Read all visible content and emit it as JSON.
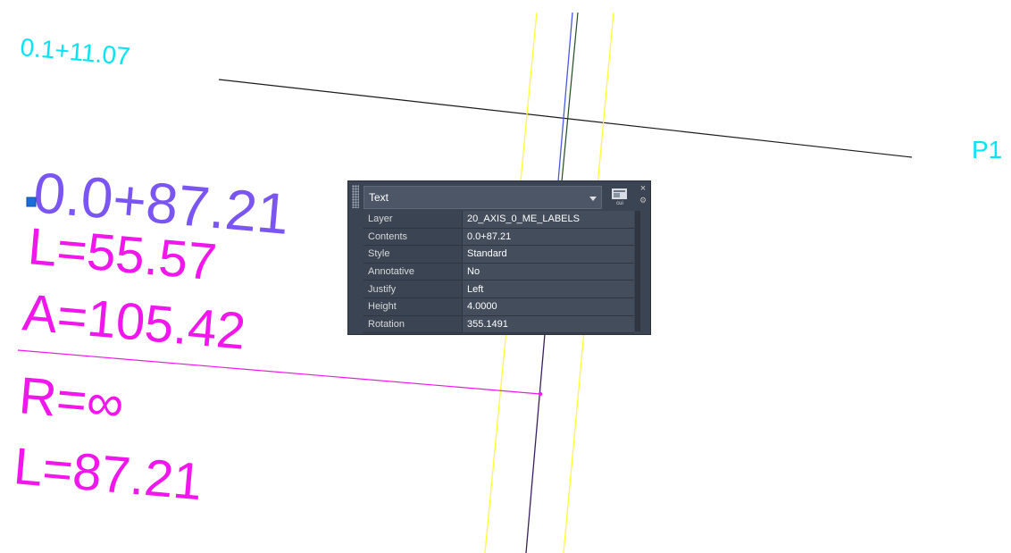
{
  "drawing": {
    "station_label_top": "0.1+11.07",
    "point_label": "P1",
    "selected_label": "0.0+87.21",
    "label_l1": "L=55.57",
    "label_a": "A=105.42",
    "label_r": "R=∞",
    "label_l2": "L=87.21",
    "colors": {
      "cyan": "#00e5f5",
      "selected_text": "#7b55f2",
      "magenta": "#f016ec",
      "yellow": "#ffff33",
      "axis_blue": "#4c57e8",
      "axis_green": "#1f4d1f",
      "axis_purple": "#3a1f5e",
      "grip": "#1a6ed8"
    }
  },
  "quick_properties": {
    "object_type": "Text",
    "cui_icon_label": "cui",
    "close_icon": "×",
    "gear_icon": "⚙",
    "properties": [
      {
        "key": "Layer",
        "value": "20_AXIS_0_ME_LABELS"
      },
      {
        "key": "Contents",
        "value": "0.0+87.21"
      },
      {
        "key": "Style",
        "value": "Standard"
      },
      {
        "key": "Annotative",
        "value": "No"
      },
      {
        "key": "Justify",
        "value": "Left"
      },
      {
        "key": "Height",
        "value": "4.0000"
      },
      {
        "key": "Rotation",
        "value": "355.1491"
      }
    ],
    "colors": {
      "panel": "#3b4453",
      "value_cell": "#444d5c",
      "text": "#e6e6e6"
    }
  }
}
